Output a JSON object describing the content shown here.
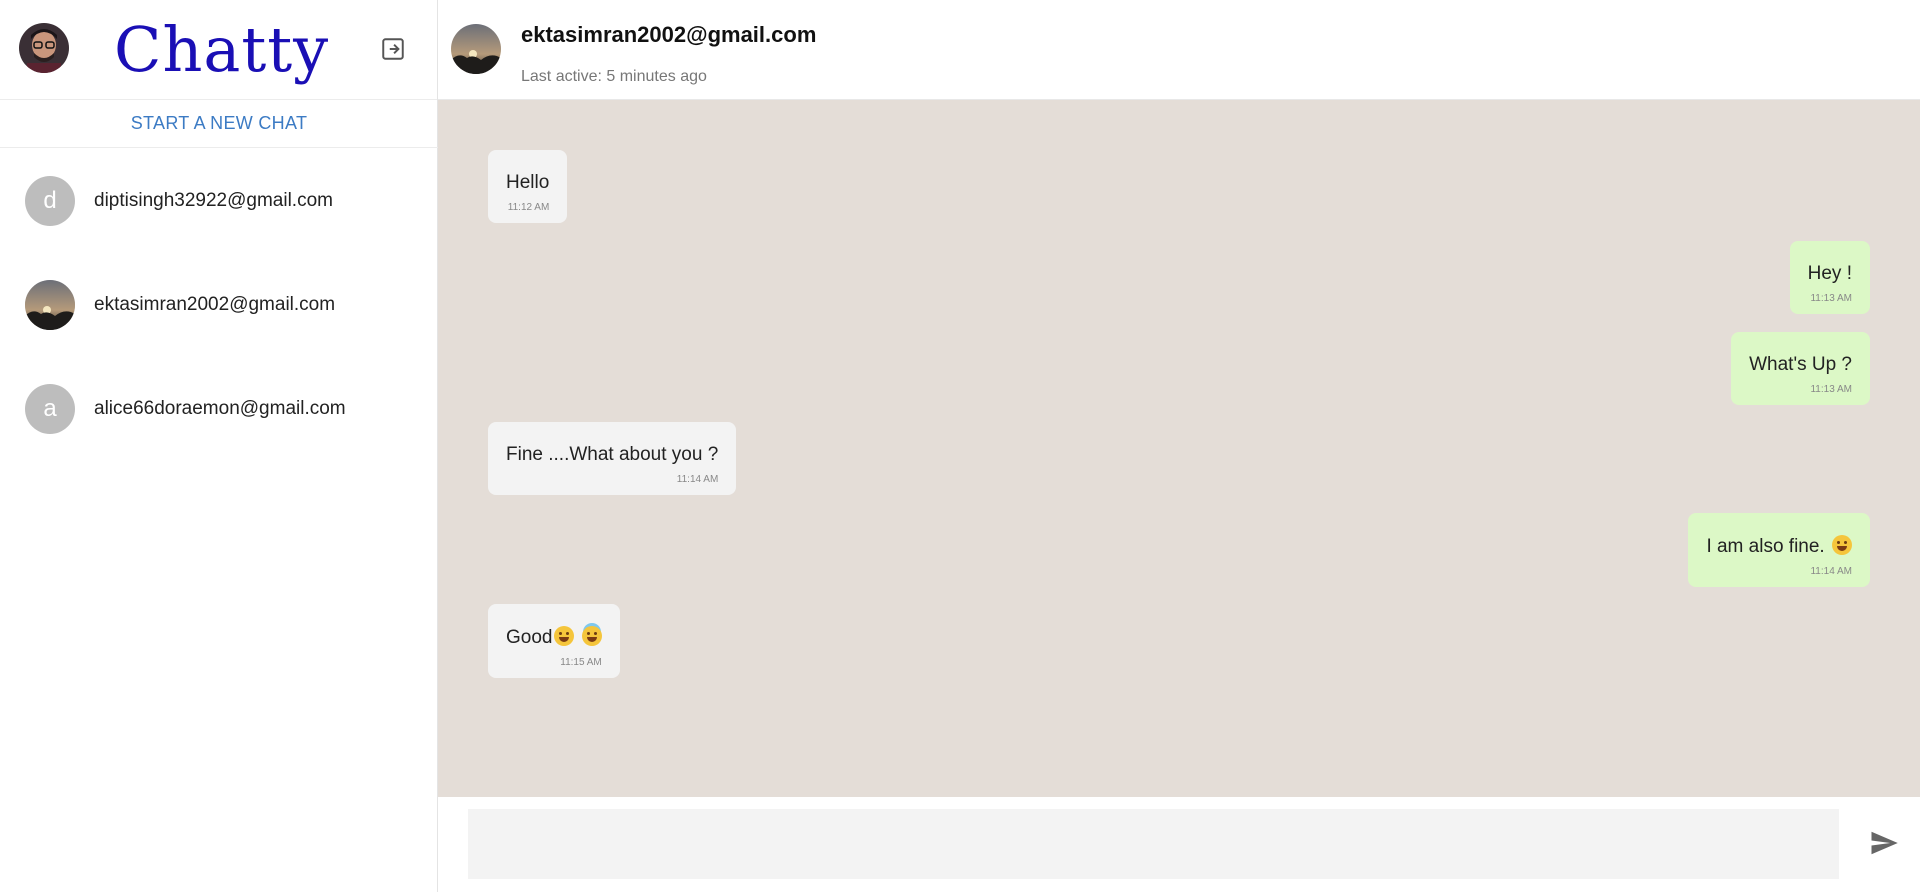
{
  "app": {
    "brand": "Chatty"
  },
  "sidebar": {
    "new_chat_label": "START A NEW CHAT",
    "contacts": [
      {
        "initial": "d",
        "email": "diptisingh32922@gmail.com",
        "avatar": "letter"
      },
      {
        "initial": "",
        "email": "ektasimran2002@gmail.com",
        "avatar": "photo"
      },
      {
        "initial": "a",
        "email": "alice66doraemon@gmail.com",
        "avatar": "letter"
      }
    ]
  },
  "chat": {
    "peer_name": "ektasimran2002@gmail.com",
    "peer_status": "Last active: 5 minutes ago",
    "messages": [
      {
        "direction": "in",
        "text": "Hello",
        "time": "11:12 AM"
      },
      {
        "direction": "out",
        "text": "Hey !",
        "time": "11:13 AM"
      },
      {
        "direction": "out",
        "text": "What's Up ?",
        "time": "11:13 AM"
      },
      {
        "direction": "in",
        "text": "Fine ....What about you ?",
        "time": "11:14 AM"
      },
      {
        "direction": "out",
        "text": "I am also fine.",
        "emoji": [
          "grinning-face"
        ],
        "time": "11:14 AM"
      },
      {
        "direction": "in",
        "text": "Good",
        "emoji": [
          "smiling-face",
          "smiling-face-with-halo"
        ],
        "time": "11:15 AM"
      }
    ]
  },
  "composer": {
    "placeholder": ""
  },
  "icons": {
    "logout": "logout-icon",
    "send": "send-icon"
  },
  "colors": {
    "brand": "#1a0fb5",
    "link": "#3c7bc4",
    "chat_bg": "#e4ddd7",
    "bubble_in": "#f3f3f3",
    "bubble_out": "#dcf8c6"
  }
}
